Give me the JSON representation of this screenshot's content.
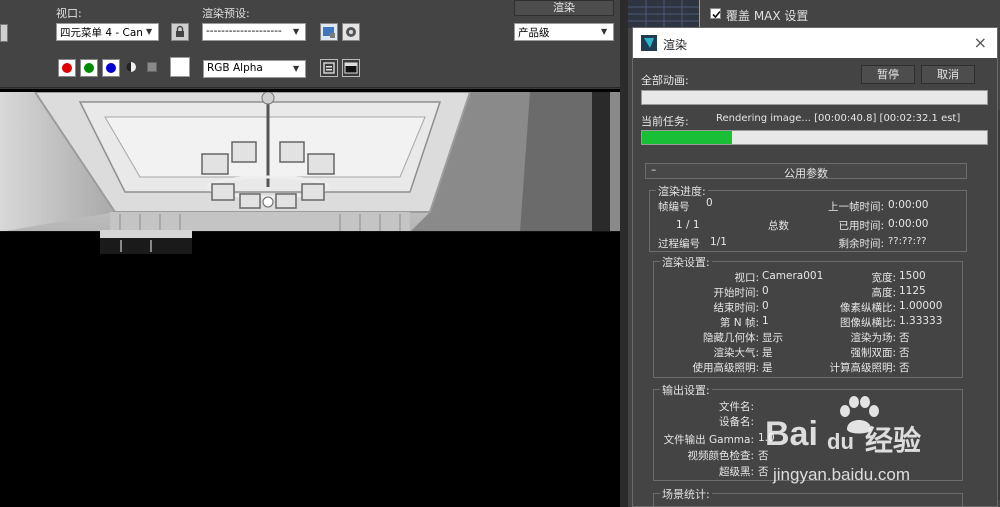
{
  "toolbar": {
    "viewport_label": "视口:",
    "viewport_value": "四元菜单 4 - Can",
    "preset_label": "渲染预设:",
    "preset_value": "--------------------",
    "render_button": "渲染",
    "quality_value": "产品级",
    "channel_value": "RGB Alpha"
  },
  "right_panel": {
    "override_label": "覆盖 MAX 设置"
  },
  "dialog": {
    "title": "渲染",
    "close": "×",
    "all_animation_label": "全部动画:",
    "pause_button": "暂停",
    "cancel_button": "取消",
    "current_task_label": "当前任务:",
    "current_task_text": "Rendering image... [00:00:40.8] [00:02:32.1 est]",
    "current_task_progress": 0.26,
    "all_animation_progress": 0.0,
    "section_header": "公用参数",
    "collapse": "–",
    "progress_group": {
      "title": "渲染进度:",
      "frame_label": "帧编号",
      "frame_value": "0",
      "frame_count": "1 / 1",
      "total_label": "总数",
      "pass_label": "过程编号",
      "pass_value": "1/1",
      "last_frame_label": "上一帧时间:",
      "last_frame_value": "0:00:00",
      "elapsed_label": "已用时间:",
      "elapsed_value": "0:00:00",
      "remaining_label": "剩余时间:",
      "remaining_value": "??:??:??"
    },
    "settings_group": {
      "title": "渲染设置:",
      "left": [
        {
          "label": "视口:",
          "value": "Camera001"
        },
        {
          "label": "开始时间:",
          "value": "0"
        },
        {
          "label": "结束时间:",
          "value": "0"
        },
        {
          "label": "第 N 帧:",
          "value": "1"
        },
        {
          "label": "隐藏几何体:",
          "value": "显示"
        },
        {
          "label": "渲染大气:",
          "value": "是"
        },
        {
          "label": "使用高级照明:",
          "value": "是"
        }
      ],
      "right": [
        {
          "label": "宽度:",
          "value": "1500"
        },
        {
          "label": "高度:",
          "value": "1125"
        },
        {
          "label": "像素纵横比:",
          "value": "1.00000"
        },
        {
          "label": "图像纵横比:",
          "value": "1.33333"
        },
        {
          "label": "渲染为场:",
          "value": "否"
        },
        {
          "label": "强制双面:",
          "value": "否"
        },
        {
          "label": "计算高级照明:",
          "value": "否"
        }
      ]
    },
    "output_group": {
      "title": "输出设置:",
      "filename_label": "文件名:",
      "device_label": "设备名:",
      "gamma_label": "文件输出 Gamma:",
      "gamma_value": "1.0",
      "video_check_label": "视频颜色检查:",
      "video_check_value": "否",
      "superblack_label": "超级黑:",
      "superblack_value": "否"
    },
    "scene_group": {
      "title": "场景统计:"
    }
  },
  "watermark": {
    "brand": "Bai",
    "brand2": "du",
    "brand_cn": "经验",
    "url": "jingyan.baidu.com"
  },
  "colors": {
    "progress_green": "#19c036",
    "panel_bg": "#444444"
  }
}
